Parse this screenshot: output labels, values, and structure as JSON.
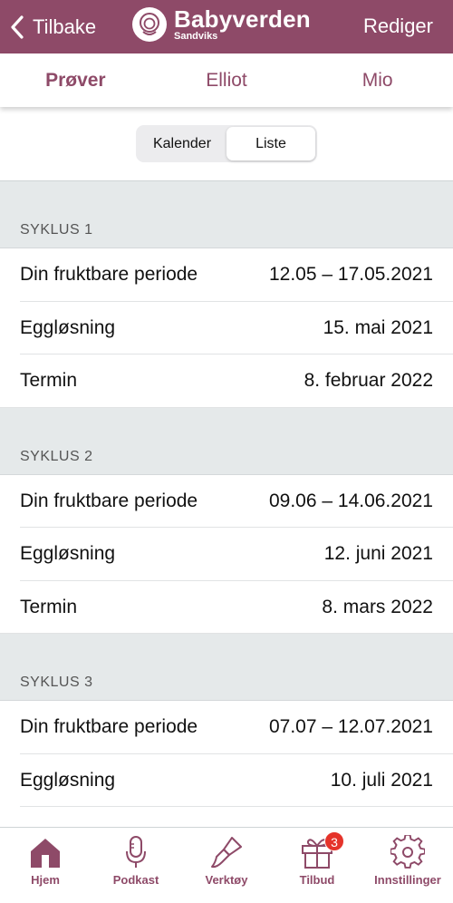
{
  "colors": {
    "brand": "#8e4a68",
    "badge": "#e5332a",
    "background": "#e5e9ea"
  },
  "header": {
    "back_label": "Tilbake",
    "brand_name": "Babyverden",
    "brand_sub": "Sandviks",
    "edit_label": "Rediger"
  },
  "tabs": [
    {
      "label": "Prøver",
      "active": true
    },
    {
      "label": "Elliot",
      "active": false
    },
    {
      "label": "Mio",
      "active": false
    }
  ],
  "segment": {
    "calendar_label": "Kalender",
    "list_label": "Liste",
    "selected": "Liste"
  },
  "cycles": [
    {
      "title": "SYKLUS 1",
      "rows": [
        {
          "label": "Din fruktbare periode",
          "value": "12.05 – 17.05.2021"
        },
        {
          "label": "Eggløsning",
          "value": "15. mai 2021"
        },
        {
          "label": "Termin",
          "value": "8. februar 2022"
        }
      ]
    },
    {
      "title": "SYKLUS 2",
      "rows": [
        {
          "label": "Din fruktbare periode",
          "value": "09.06 – 14.06.2021"
        },
        {
          "label": "Eggløsning",
          "value": "12. juni 2021"
        },
        {
          "label": "Termin",
          "value": "8. mars 2022"
        }
      ]
    },
    {
      "title": "SYKLUS 3",
      "rows": [
        {
          "label": "Din fruktbare periode",
          "value": "07.07 – 12.07.2021"
        },
        {
          "label": "Eggløsning",
          "value": "10. juli 2021"
        }
      ]
    }
  ],
  "bottom_nav": [
    {
      "label": "Hjem",
      "icon": "home-icon"
    },
    {
      "label": "Podkast",
      "icon": "microphone-icon"
    },
    {
      "label": "Verktøy",
      "icon": "brush-icon"
    },
    {
      "label": "Tilbud",
      "icon": "gift-icon",
      "badge": "3"
    },
    {
      "label": "Innstillinger",
      "icon": "gear-icon"
    }
  ]
}
